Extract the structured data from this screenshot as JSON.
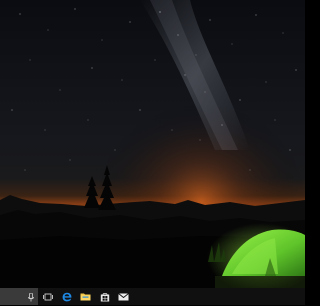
{
  "desktop": {
    "wallpaper": "night-sky-milky-way-tent-icon",
    "colors": {
      "sky_top": "#0b0d12",
      "sky_mid": "#15171c",
      "glow": "#b0501a",
      "mountain": "#0c0b0b",
      "tent": "#7ee03a"
    }
  },
  "taskbar": {
    "background": "#101010",
    "search_box_color": "#3a3a3a",
    "icons": [
      "microphone-icon",
      "task-view-icon",
      "edge-browser-icon",
      "file-explorer-icon",
      "store-icon",
      "mail-icon"
    ]
  }
}
